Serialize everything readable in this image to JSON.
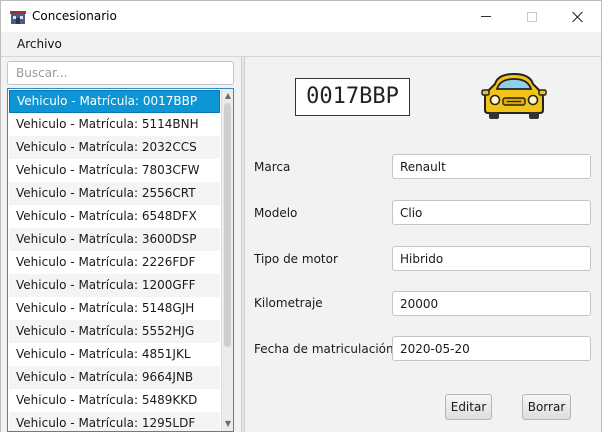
{
  "window": {
    "title": "Concesionario"
  },
  "menu": {
    "items": [
      {
        "label": "Archivo"
      }
    ]
  },
  "search": {
    "placeholder": "Buscar..."
  },
  "list": {
    "items": [
      "Vehiculo - Matrícula: 0017BBP",
      "Vehiculo - Matrícula: 5114BNH",
      "Vehiculo - Matrícula: 2032CCS",
      "Vehiculo - Matrícula: 7803CFW",
      "Vehiculo - Matrícula: 2556CRT",
      "Vehiculo - Matrícula: 6548DFX",
      "Vehiculo - Matrícula: 3600DSP",
      "Vehiculo - Matrícula: 2226FDF",
      "Vehiculo - Matrícula: 1200GFF",
      "Vehiculo - Matrícula: 5148GJH",
      "Vehiculo - Matrícula: 5552HJG",
      "Vehiculo - Matrícula: 4851JKL",
      "Vehiculo - Matrícula: 9664JNB",
      "Vehiculo - Matrícula: 5489KKD",
      "Vehiculo - Matrícula: 1295LDF"
    ],
    "selected_index": 0
  },
  "detail": {
    "plate": "0017BBP",
    "car_icon": "car-icon",
    "fields": [
      {
        "label": "Marca",
        "value": "Renault"
      },
      {
        "label": "Modelo",
        "value": "Clio"
      },
      {
        "label": "Tipo de motor",
        "value": "Hibrido"
      },
      {
        "label": "Kilometraje",
        "value": "20000"
      },
      {
        "label": "Fecha de matriculación",
        "value": "2020-05-20"
      }
    ]
  },
  "buttons": {
    "edit_label": "Editar",
    "delete_label": "Borrar"
  },
  "colors": {
    "selection": "#0c96d6",
    "list_border": "#2d8dcc",
    "car_body": "#f2c318"
  }
}
